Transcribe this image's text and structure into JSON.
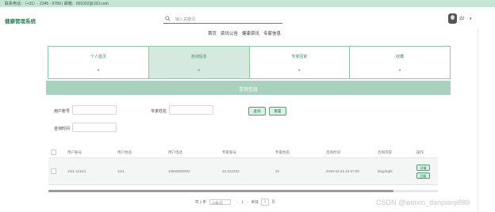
{
  "topbar": {
    "contact": "联系电话：（+31）- 2345 - 6789 | 邮箱：001002@163.com"
  },
  "brand": "健康管理系统",
  "search": {
    "placeholder": "输入关键词"
  },
  "user": {
    "name": "22",
    "caret": "▾"
  },
  "nav": [
    {
      "label": "首页"
    },
    {
      "label": "资讯公告"
    },
    {
      "label": "健康资讯"
    },
    {
      "label": "专家信息"
    }
  ],
  "cards": [
    {
      "label": "个人首页",
      "dot": "●",
      "active": false
    },
    {
      "label": "咨询信息",
      "dot": "●",
      "active": true
    },
    {
      "label": "专家回复",
      "dot": "●",
      "active": false
    },
    {
      "label": "收藏",
      "dot": "●",
      "active": false
    }
  ],
  "banner": "咨询信息",
  "filters": {
    "user_account": "用户账号",
    "expert_name": "专家姓名",
    "consult_time": "咨询时间",
    "search_btn": "查询",
    "reset_btn": "重置"
  },
  "table": {
    "headers": [
      "用户账号",
      "用户姓名",
      "用户电话",
      "专家账号",
      "专家姓名",
      "咨询时间",
      "咨询内容",
      "操作"
    ],
    "rows": [
      {
        "cells": [
          "1111-1111/1",
          "1111",
          "13800000003",
          "22-222222",
          "22",
          "2020-04-23 10:37:00",
          "blogrbqbl"
        ],
        "actions": [
          "详情",
          "回复"
        ]
      }
    ]
  },
  "pager": {
    "total": "共 1 条",
    "size": "10条/页",
    "prev": "‹",
    "page": "1",
    "next": "›",
    "goto": "前往",
    "goto_page": "1",
    "unit": "页"
  },
  "watermark": "CSDN @weixin_danpianji889"
}
